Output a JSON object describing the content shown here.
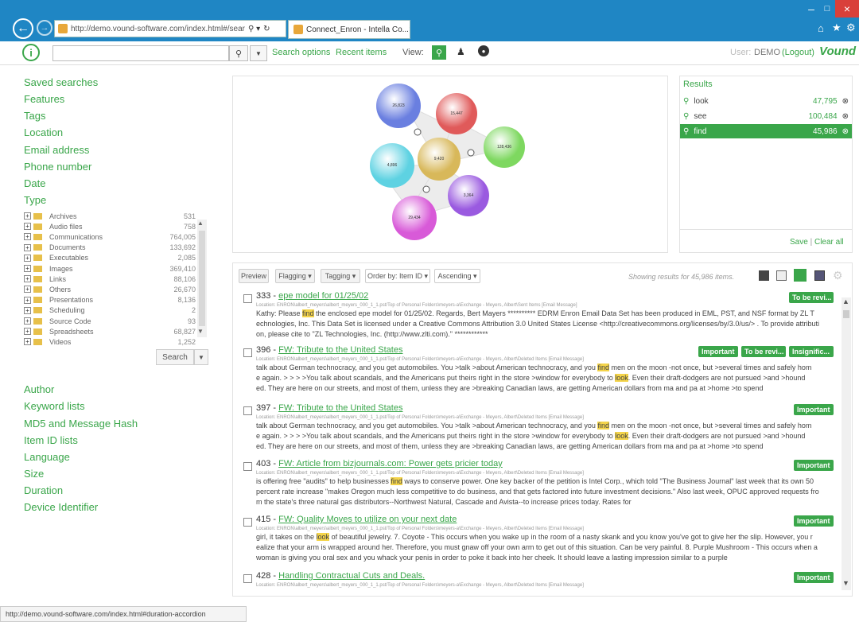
{
  "browser": {
    "url": "http://demo.vound-software.com/index.html#/sear",
    "tab_title": "Connect_Enron - Intella Co...",
    "status_url": "http://demo.vound-software.com/index.html#duration-accordion"
  },
  "header": {
    "search_options": "Search options",
    "recent_items": "Recent items",
    "view_label": "View:",
    "user_label": "User:",
    "user_name": "DEMO",
    "logout": "(Logout)",
    "brand": "Vound"
  },
  "sidebar": {
    "facets_top": [
      "Saved searches",
      "Features",
      "Tags",
      "Location",
      "Email address",
      "Phone number",
      "Date",
      "Type"
    ],
    "types": [
      {
        "label": "Archives",
        "count": "531"
      },
      {
        "label": "Audio files",
        "count": "758"
      },
      {
        "label": "Communications",
        "count": "764,005"
      },
      {
        "label": "Documents",
        "count": "133,692"
      },
      {
        "label": "Executables",
        "count": "2,085"
      },
      {
        "label": "Images",
        "count": "369,410"
      },
      {
        "label": "Links",
        "count": "88,106"
      },
      {
        "label": "Others",
        "count": "26,670"
      },
      {
        "label": "Presentations",
        "count": "8,136"
      },
      {
        "label": "Scheduling",
        "count": "2"
      },
      {
        "label": "Source Code",
        "count": "93"
      },
      {
        "label": "Spreadsheets",
        "count": "68,827"
      },
      {
        "label": "Videos",
        "count": "1,252"
      }
    ],
    "search_button": "Search",
    "facets_bottom": [
      "Author",
      "Keyword lists",
      "MD5 and Message Hash",
      "Item ID lists",
      "Language",
      "Size",
      "Duration",
      "Device Identifier"
    ]
  },
  "cluster": {
    "bubbles": [
      {
        "label": "26,823",
        "color": "#6a7fe0"
      },
      {
        "label": "15,447",
        "color": "#e05a5a"
      },
      {
        "label": "128,436",
        "color": "#7ed860"
      },
      {
        "label": "9,420",
        "color": "#d8b85a"
      },
      {
        "label": "4,896",
        "color": "#5ed2e2"
      },
      {
        "label": "3,364",
        "color": "#9a5ae0"
      },
      {
        "label": "29,434",
        "color": "#d85ad8"
      }
    ]
  },
  "results": {
    "title": "Results",
    "items": [
      {
        "term": "look",
        "count": "47,795",
        "selected": false
      },
      {
        "term": "see",
        "count": "100,484",
        "selected": false
      },
      {
        "term": "find",
        "count": "45,986",
        "selected": true
      }
    ],
    "save": "Save",
    "sep": "|",
    "clear": "Clear all"
  },
  "toolbar": {
    "preview": "Preview",
    "flagging": "Flagging ▾",
    "tagging": "Tagging ▾",
    "order": "Order by: Item ID ▾",
    "ascending": "Ascending ▾",
    "showing": "Showing results for 45,986 items."
  },
  "rows": [
    {
      "id": "333",
      "sep": " - ",
      "title": "epe model for 01/25/02",
      "link_title": false,
      "loc": "Location: ENRON\\albert_meyers\\albert_meyers_000_1_1.pst/Top of Personal Folders\\meyers-a\\Exchange - Meyers, Albert\\Sent Items [Email Message]",
      "lines": [
        [
          "Kathy: Please ",
          "find",
          " the enclosed epe model for 01/25/02. Regards, Bert Mayers ********** EDRM Enron Email Data Set has been produced in EML, PST, and NSF format by ZL T"
        ],
        [
          "echnologies, Inc. This Data Set is licensed under a Creative Commons Attribution 3.0 United States License <http://creativecommons.org/licenses/by/3.0/us/> . To provide attributi"
        ],
        [
          "on, please cite to \"ZL Technologies, Inc. (http://www.zlti.com).\" ************"
        ]
      ],
      "badges": [
        "To be revi..."
      ]
    },
    {
      "id": "396",
      "sep": " - ",
      "title": "FW: Tribute to the United States",
      "link_title": true,
      "loc": "Location: ENRON\\albert_meyers\\albert_meyers_000_1_1.pst/Top of Personal Folders\\meyers-a\\Exchange - Meyers, Albert\\Deleted Items [Email Message]",
      "lines": [
        [
          "talk about German technocracy, and you get automobiles. You >talk >about American technocracy, and you ",
          "find",
          " men on the moon -not once, but >several times and safely hom"
        ],
        [
          "e again. > > > >You talk about scandals, and the Americans put theirs right in the store >window for everybody to ",
          "look",
          ". Even their draft-dodgers are not pursued >and >hound"
        ],
        [
          "ed. They are here on our streets, and most of them, unless they are >breaking Canadian laws, are getting American dollars from ma and pa at >home >to spend"
        ]
      ],
      "badges": [
        "Important",
        "To be revi...",
        "Insignific..."
      ]
    },
    {
      "id": "397",
      "sep": " - ",
      "title": "FW: Tribute to the United States",
      "link_title": true,
      "loc": "Location: ENRON\\albert_meyers\\albert_meyers_000_1_1.pst/Top of Personal Folders\\meyers-a\\Exchange - Meyers, Albert\\Deleted Items [Email Message]",
      "lines": [
        [
          "talk about German technocracy, and you get automobiles. You >talk >about American technocracy, and you ",
          "find",
          " men on the moon -not once, but >several times and safely hom"
        ],
        [
          "e again. > > > >You talk about scandals, and the Americans put theirs right in the store >window for everybody to ",
          "look",
          ". Even their draft-dodgers are not pursued >and >hound"
        ],
        [
          "ed. They are here on our streets, and most of them, unless they are >breaking Canadian laws, are getting American dollars from ma and pa at >home >to spend"
        ]
      ],
      "badges": [
        "Important"
      ]
    },
    {
      "id": "403",
      "sep": " - ",
      "title": "FW: Article from bizjournals.com: Power gets pricier today",
      "link_title": true,
      "loc": "Location: ENRON\\albert_meyers\\albert_meyers_000_1_1.pst/Top of Personal Folders\\meyers-a\\Exchange - Meyers, Albert\\Deleted Items [Email Message]",
      "lines": [
        [
          "is offering free \"audits\" to help businesses ",
          "find",
          " ways to conserve power. One key backer of the petition is Intel Corp., which told \"The Business Journal\" last week that its own 50"
        ],
        [
          "percent rate increase \"makes Oregon much less competitive to do business, and that gets factored into future investment decisions.\" Also last week, OPUC approved requests fro"
        ],
        [
          "m the state's three natural gas distributors--Northwest Natural, Cascade and Avista--to increase prices today. Rates for"
        ]
      ],
      "badges": [
        "Important"
      ]
    },
    {
      "id": "415",
      "sep": " - ",
      "title": "FW: Quality Moves to utilize on your next date",
      "link_title": true,
      "loc": "Location: ENRON\\albert_meyers\\albert_meyers_000_1_1.pst/Top of Personal Folders\\meyers-a\\Exchange - Meyers, Albert\\Deleted Items [Email Message]",
      "lines": [
        [
          "girl, it takes on the ",
          "look",
          " of beautiful jewelry. 7. Coyote - This occurs when you wake up in the room of a nasty skank and you know you've got to give her the slip. However, you r"
        ],
        [
          "ealize that your arm is wrapped around her. Therefore, you must gnaw off your own arm to get out of this situation. Can be very painful. 8. Purple Mushroom - This occurs when a"
        ],
        [
          "woman is giving you oral sex and you whack your penis in order to poke it back into her cheek. It should leave a lasting impression similar to a purple"
        ]
      ],
      "badges": [
        "Important"
      ]
    },
    {
      "id": "428",
      "sep": " - ",
      "title": "Handling Contractual Cuts and Deals.",
      "link_title": false,
      "loc": "Location: ENRON\\albert_meyers\\albert_meyers_000_1_1.pst/Top of Personal Folders\\meyers-a\\Exchange - Meyers, Albert\\Deleted Items [Email Message]",
      "lines": [],
      "badges": [
        "Important"
      ]
    }
  ]
}
